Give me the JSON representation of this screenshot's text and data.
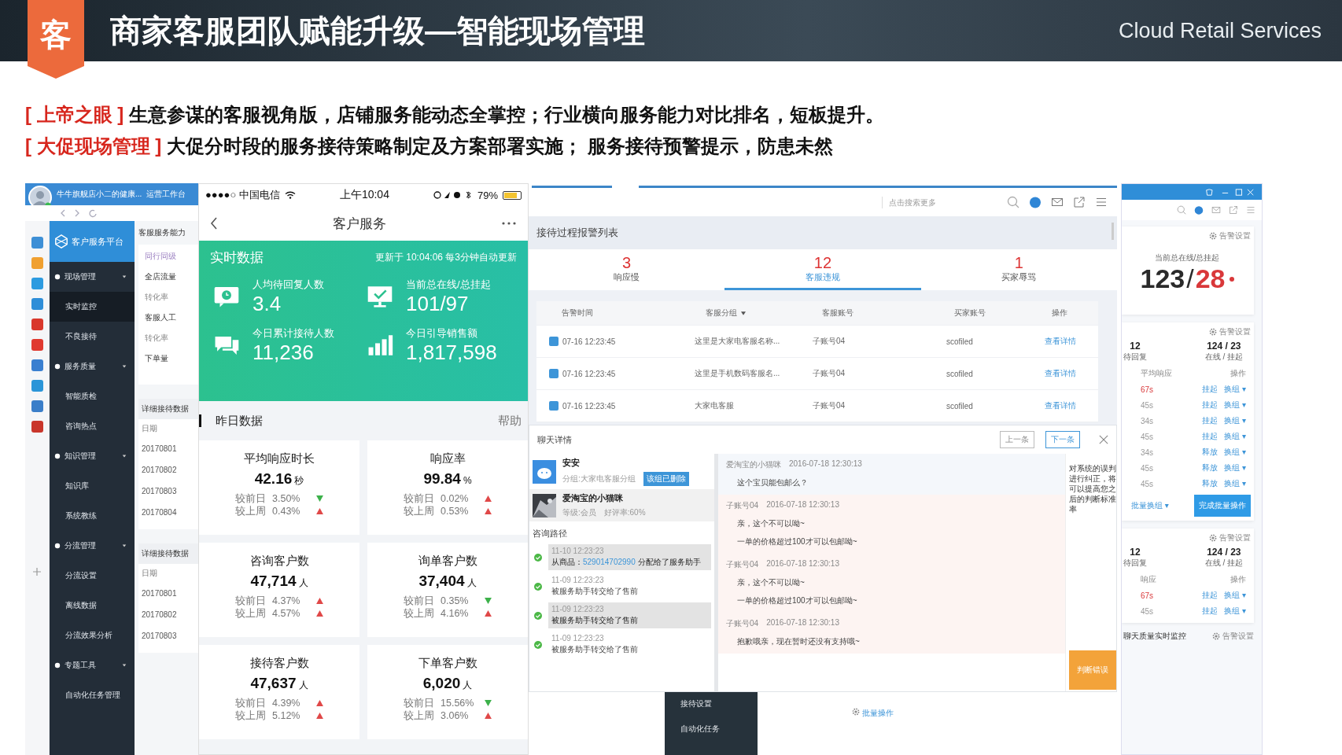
{
  "header": {
    "badge": "客",
    "title": "商家客服团队赋能升级—智能现场管理",
    "brand": "Cloud Retail Services"
  },
  "intro": [
    {
      "tag": "[ 上帝之眼 ]",
      "text": "生意参谋的客服视角版，店铺服务能动态全掌控；行业横向服务能力对比排名，短板提升。"
    },
    {
      "tag": "[ 大促现场管理 ]",
      "text": "大促分时段的服务接待策略制定及方案部署实施； 服务接待预警提示，防患未然"
    }
  ],
  "desktop_app": {
    "user": "牛牛旗舰店小二的健康...",
    "workspace": "运营工作台",
    "platform": "客户服务平台",
    "nav": [
      {
        "label": "现场管理",
        "expanded": true,
        "children": [
          {
            "label": "实时监控",
            "selected": true
          },
          {
            "label": "不良接待",
            "selected": false
          }
        ]
      },
      {
        "label": "服务质量",
        "expanded": true,
        "children": [
          {
            "label": "智能质检",
            "selected": false
          },
          {
            "label": "咨询热点",
            "selected": false
          }
        ]
      },
      {
        "label": "知识管理",
        "expanded": true,
        "children": [
          {
            "label": "知识库",
            "selected": false
          },
          {
            "label": "系统教练",
            "selected": false
          }
        ]
      },
      {
        "label": "分流管理",
        "expanded": true,
        "children": [
          {
            "label": "分流设置",
            "selected": false
          },
          {
            "label": "离线数据",
            "selected": false
          },
          {
            "label": "分流效果分析",
            "selected": false
          }
        ]
      },
      {
        "label": "专题工具",
        "expanded": true,
        "children": [
          {
            "label": "自动化任务管理",
            "selected": false
          }
        ]
      }
    ],
    "page_title": "客服服务能力",
    "legend": "同行同级",
    "metrics": [
      {
        "label": "全店流量",
        "kind": "main"
      },
      {
        "label": "转化率",
        "kind": "sub"
      },
      {
        "label": "客服人工",
        "kind": "main"
      },
      {
        "label": "转化率",
        "kind": "sub"
      },
      {
        "label": "下单量",
        "kind": "main"
      }
    ],
    "tables": [
      {
        "title": "详细接待数据",
        "column": "日期",
        "rows": [
          "20170801",
          "20170802",
          "20170803",
          "20170804"
        ]
      },
      {
        "title": "详细接待数据",
        "column": "日期",
        "rows": [
          "20170801",
          "20170802",
          "20170803"
        ]
      }
    ]
  },
  "phone": {
    "carrier": "●●●●○ 中国电信",
    "time": "上午10:04",
    "battery": "79%",
    "title": "客户服务",
    "realtime": {
      "title": "实时数据",
      "updated": "更新于 10:04:06 每3分钟自动更新",
      "stats": [
        {
          "label": "人均待回复人数",
          "value": "3.4"
        },
        {
          "label": "当前总在线/总挂起",
          "value": "101/97"
        },
        {
          "label": "今日累计接待人数",
          "value": "11,236"
        },
        {
          "label": "今日引导销售额",
          "value": "1,817,598"
        }
      ]
    },
    "yesterday": {
      "title": "昨日数据",
      "help": "帮助",
      "cards": [
        {
          "title": "平均响应时长",
          "value": "42.16",
          "unit": "秒",
          "rows": [
            {
              "label": "较前日",
              "value": "3.50%",
              "rising": false
            },
            {
              "label": "较上周",
              "value": "0.43%",
              "rising": true
            }
          ]
        },
        {
          "title": "响应率",
          "value": "99.84",
          "unit": "%",
          "rows": [
            {
              "label": "较前日",
              "value": "0.02%",
              "rising": true
            },
            {
              "label": "较上周",
              "value": "0.53%",
              "rising": true
            }
          ]
        },
        {
          "title": "咨询客户数",
          "value": "47,714",
          "unit": "人",
          "rows": [
            {
              "label": "较前日",
              "value": "4.37%",
              "rising": true
            },
            {
              "label": "较上周",
              "value": "4.57%",
              "rising": true
            }
          ]
        },
        {
          "title": "询单客户数",
          "value": "37,404",
          "unit": "人",
          "rows": [
            {
              "label": "较前日",
              "value": "0.35%",
              "rising": false
            },
            {
              "label": "较上周",
              "value": "4.16%",
              "rising": true
            }
          ]
        },
        {
          "title": "接待客户数",
          "value": "47,637",
          "unit": "人",
          "rows": [
            {
              "label": "较前日",
              "value": "4.39%",
              "rising": true
            },
            {
              "label": "较上周",
              "value": "5.12%",
              "rising": true
            }
          ]
        },
        {
          "title": "下单客户数",
          "value": "6,020",
          "unit": "人",
          "rows": [
            {
              "label": "较前日",
              "value": "15.56%",
              "rising": false
            },
            {
              "label": "较上周",
              "value": "3.06%",
              "rising": true
            }
          ]
        }
      ]
    }
  },
  "alert_window": {
    "search": {
      "placeholder": "点击搜索更多"
    },
    "title": "接待过程报警列表",
    "tabs": [
      {
        "count": "3",
        "label": "响应慢",
        "selected": false
      },
      {
        "count": "12",
        "label": "客服违规",
        "selected": true
      },
      {
        "count": "1",
        "label": "买家辱骂",
        "selected": false
      }
    ],
    "columns": [
      "告警时间",
      "客服分组",
      "客服账号",
      "买家账号",
      "操作"
    ],
    "rows": [
      {
        "time": "07-16  12:23:45",
        "group": "这里是大家电客服名称...",
        "account": "子账号04",
        "buyer": "scofiled",
        "action": "查看详情"
      },
      {
        "time": "07-16  12:23:45",
        "group": "这里是手机数码客服名...",
        "account": "子账号04",
        "buyer": "scofiled",
        "action": "查看详情"
      },
      {
        "time": "07-16  12:23:45",
        "group": "大家电客服",
        "account": "子账号04",
        "buyer": "scofiled",
        "action": "查看详情"
      }
    ]
  },
  "chat_window": {
    "title": "聊天详情",
    "prev": "上一条",
    "next": "下一条",
    "agent": {
      "name": "安安",
      "group": "分组:大家电客服分组",
      "tag": "该组已删除"
    },
    "customer": {
      "name": "爱淘宝的小猫咪",
      "level": "等级:会员",
      "rate": "好评率:60%"
    },
    "path_title": "咨询路径",
    "path": [
      {
        "time": "11-10  12:23:23",
        "prefix": "从商品：",
        "link": "529014702990",
        "suffix": " 分配给了服务助手",
        "selected": true
      },
      {
        "time": "11-09  12:23:23",
        "prefix": "被服务助手转交给了售前",
        "selected": false
      },
      {
        "time": "11-09  12:23:23",
        "prefix": "被服务助手转交给了售前",
        "selected": true
      },
      {
        "time": "11-09  12:23:23",
        "prefix": "被服务助手转交给了售前",
        "selected": false
      }
    ],
    "messages": [
      {
        "kind": "buyer",
        "sender": "爱淘宝的小猫咪",
        "time": "2016-07-18  12:30:13",
        "lines": [
          "这个宝贝能包邮么？"
        ]
      },
      {
        "kind": "agent",
        "sender": "子账号04",
        "time": "2016-07-18  12:30:13",
        "lines": [
          "亲，这个不可以呦~",
          "一单的价格超过100才可以包邮呦~"
        ]
      },
      {
        "kind": "agent",
        "sender": "子账号04",
        "time": "2016-07-18  12:30:13",
        "lines": [
          "亲，这个不可以呦~",
          "一单的价格超过100才可以包邮呦~"
        ]
      },
      {
        "kind": "agent",
        "sender": "子账号04",
        "time": "2016-07-18  12:30:13",
        "lines": [
          "抱歉哦亲，现在暂时还没有支持哦~"
        ]
      }
    ],
    "note": "对系统的误判进行纠正，将可以提高您之后的判断标准率",
    "judge": "判断错误"
  },
  "under_chat": {
    "menu": [
      "接待设置",
      "自动化任务"
    ],
    "batch": "批量操作"
  },
  "right_window": {
    "alert_setting": "告警设置",
    "online_label": "当前总在线/总挂起",
    "online": "123",
    "separator": "/",
    "hung": "28",
    "cards": [
      {
        "setting": "告警设置",
        "waiting": "12",
        "waiting_label": "待回复",
        "online": "124 / 23",
        "online_label": "在线 / 挂起",
        "col_a": "平均响应",
        "col_b": "操作",
        "rows": [
          {
            "time": "67s",
            "late": true,
            "act": "挂起",
            "swap": "换组 ▾"
          },
          {
            "time": "45s",
            "late": false,
            "act": "挂起",
            "swap": "换组 ▾"
          },
          {
            "time": "34s",
            "late": false,
            "act": "挂起",
            "swap": "换组 ▾"
          },
          {
            "time": "45s",
            "late": false,
            "act": "挂起",
            "swap": "换组 ▾"
          },
          {
            "time": "34s",
            "late": false,
            "act": "释放",
            "swap": "换组 ▾"
          },
          {
            "time": "45s",
            "late": false,
            "act": "释放",
            "swap": "换组 ▾"
          },
          {
            "time": "45s",
            "late": false,
            "act": "释放",
            "swap": "换组 ▾"
          }
        ],
        "batch": "批量换组 ▾",
        "done": "完成批量操作"
      },
      {
        "setting": "告警设置",
        "waiting": "12",
        "waiting_label": "待回复",
        "online": "124 / 23",
        "online_label": "在线 / 挂起",
        "col_a": "响应",
        "col_b": "操作",
        "rows": [
          {
            "time": "67s",
            "late": true,
            "act": "挂起",
            "swap": "换组 ▾"
          },
          {
            "time": "45s",
            "late": false,
            "act": "挂起",
            "swap": "换组 ▾"
          }
        ]
      }
    ],
    "footer": "聊天质量实时监控",
    "footer_setting": "告警设置"
  }
}
